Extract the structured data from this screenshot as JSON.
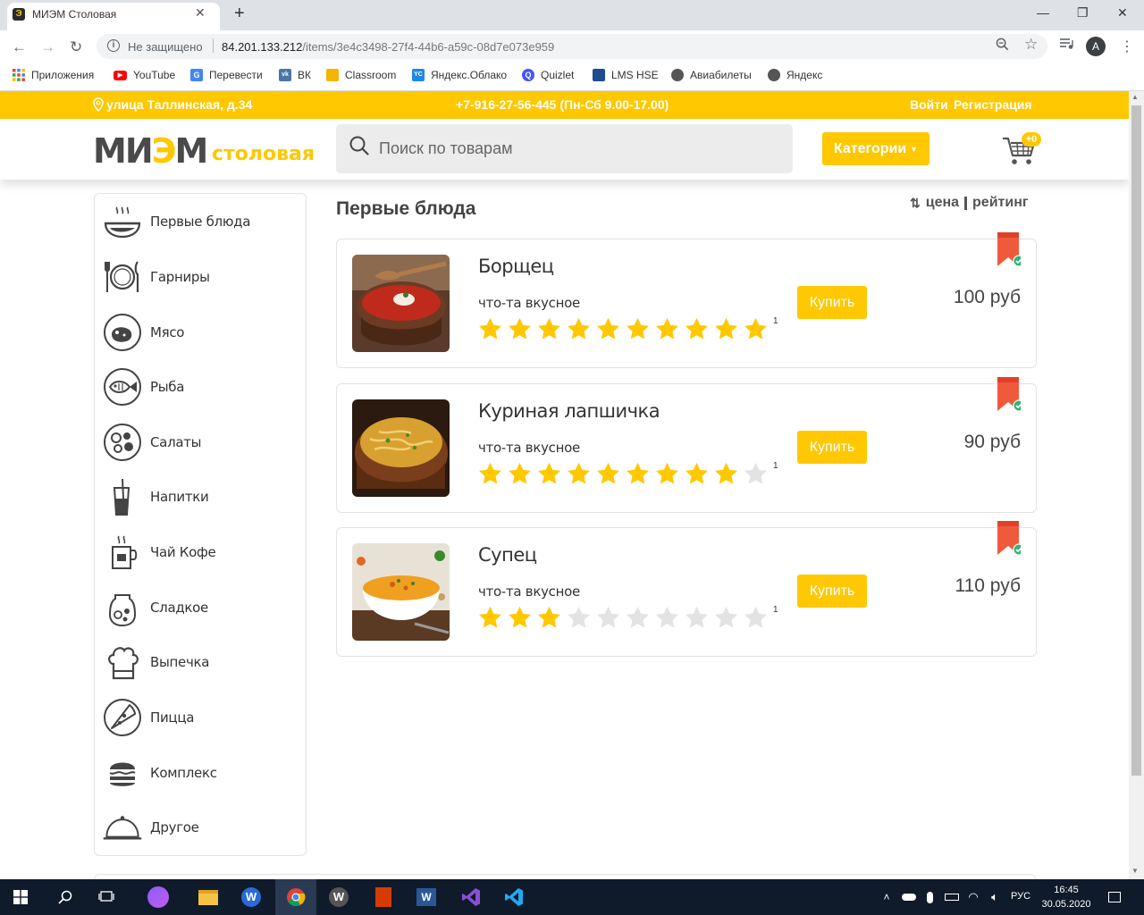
{
  "browser": {
    "tab_title": "МИЭМ Столовая",
    "security_text": "Не защищено",
    "url_host": "84.201.133.212",
    "url_path": "/items/3e4c3498-27f4-44b6-a59c-08d7e073e959",
    "avatar_letter": "A"
  },
  "bookmarks": [
    {
      "label": "Приложения",
      "icon": "apps-grid-icon"
    },
    {
      "label": "YouTube",
      "icon": "youtube-icon",
      "color": "#ff0000"
    },
    {
      "label": "Перевести",
      "icon": "translate-icon",
      "color": "#4285f4"
    },
    {
      "label": "ВК",
      "icon": "vk-icon",
      "color": "#4a76a8"
    },
    {
      "label": "Classroom",
      "icon": "classroom-icon",
      "color": "#f4b400"
    },
    {
      "label": "Яндекс.Облако",
      "icon": "yandex-cloud-icon",
      "color": "#1e88e5"
    },
    {
      "label": "Quizlet",
      "icon": "quizlet-icon",
      "color": "#4255ff"
    },
    {
      "label": "LMS HSE",
      "icon": "lms-icon",
      "color": "#1e4c8f"
    },
    {
      "label": "Авиабилеты",
      "icon": "globe-icon",
      "color": "#555555"
    },
    {
      "label": "Яндекс",
      "icon": "globe-icon",
      "color": "#555555"
    }
  ],
  "site": {
    "address": "улица Таллинская, д.34",
    "phone": "+7-916-27-56-445 (Пн-Сб 9.00-17.00)",
    "login": "Войти",
    "register": "Регистрация",
    "logo_main_a": "МИ",
    "logo_main_b": "Э",
    "logo_main_c": "М",
    "logo_sub": "столовая",
    "search_placeholder": "Поиск по товарам",
    "categories_button": "Категории",
    "cart_count": "+0",
    "accent_color": "#ffc800"
  },
  "sidebar": {
    "items": [
      {
        "label": "Первые блюда",
        "icon": "soup-bowl-icon"
      },
      {
        "label": "Гарниры",
        "icon": "plate-cutlery-icon"
      },
      {
        "label": "Мясо",
        "icon": "meat-icon"
      },
      {
        "label": "Рыба",
        "icon": "fish-icon"
      },
      {
        "label": "Салаты",
        "icon": "salad-icon"
      },
      {
        "label": "Напитки",
        "icon": "drink-icon"
      },
      {
        "label": "Чай Кофе",
        "icon": "coffee-icon"
      },
      {
        "label": "Сладкое",
        "icon": "sweets-jar-icon"
      },
      {
        "label": "Выпечка",
        "icon": "chef-hat-icon"
      },
      {
        "label": "Пицца",
        "icon": "pizza-icon"
      },
      {
        "label": "Комплекс",
        "icon": "burger-icon"
      },
      {
        "label": "Другое",
        "icon": "cloche-icon"
      }
    ]
  },
  "main": {
    "section_title": "Первые блюда",
    "sort_price": "цена",
    "sort_rating": "рейтинг",
    "products": [
      {
        "name": "Борщец",
        "description": "что-та вкусное",
        "rating": 10,
        "rating_max": 10,
        "rating_count": "1",
        "buy_label": "Купить",
        "price": "100 руб",
        "image": "borscht"
      },
      {
        "name": "Куриная лапшичка",
        "description": "что-та вкусное",
        "rating": 9,
        "rating_max": 10,
        "rating_count": "1",
        "buy_label": "Купить",
        "price": "90 руб",
        "image": "noodle-soup"
      },
      {
        "name": "Супец",
        "description": "что-та вкусное",
        "rating": 3,
        "rating_max": 10,
        "rating_count": "1",
        "buy_label": "Купить",
        "price": "110 руб",
        "image": "pumpkin-soup"
      }
    ]
  },
  "taskbar": {
    "language": "РУС",
    "time": "16:45",
    "date": "30.05.2020"
  }
}
